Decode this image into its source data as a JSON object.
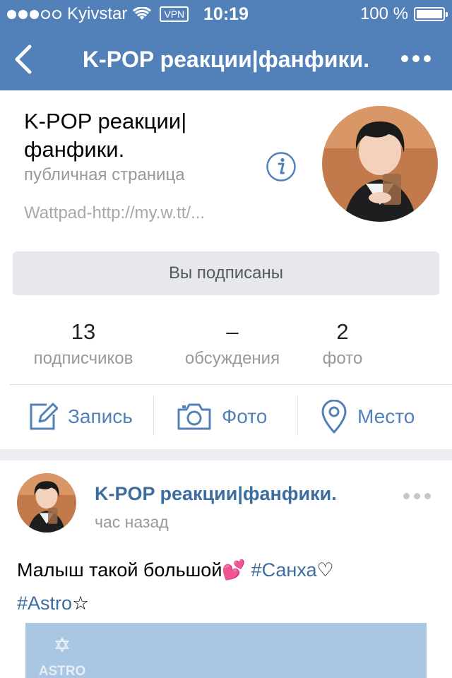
{
  "status_bar": {
    "carrier": "Kyivstar",
    "vpn": "VPN",
    "time": "10:19",
    "battery": "100 %",
    "signal_bars_filled": 3,
    "signal_bars_total": 5
  },
  "nav": {
    "title": "K-POP реакции|фанфики.",
    "back_icon": "back-chevron-icon",
    "menu_icon": "more-dots-icon"
  },
  "group": {
    "name": "K-POP реакции|фанфики.",
    "type": "публичная страница",
    "description": "Wattpad-http://my.w.tt/...",
    "subscribe_label": "Вы подписаны"
  },
  "stats": [
    {
      "value": "13",
      "label": "подписчиков"
    },
    {
      "value": "–",
      "label": "обсуждения"
    },
    {
      "value": "2",
      "label": "фото"
    }
  ],
  "actions": [
    {
      "label": "Запись",
      "icon": "edit-icon"
    },
    {
      "label": "Фото",
      "icon": "camera-icon"
    },
    {
      "label": "Место",
      "icon": "location-pin-icon"
    }
  ],
  "post": {
    "author": "K-POP реакции|фанфики.",
    "time": "час назад",
    "text_main": "Малыш такой большой",
    "emoji": "💕",
    "tag1": "#Санха",
    "tag1_suffix": "♡",
    "tag2": "#Astro",
    "tag2_suffix": "☆",
    "image_text": "ASTRO"
  },
  "colors": {
    "header": "#5181b8",
    "link": "#3d6ca1",
    "background": "#ebedf0"
  }
}
